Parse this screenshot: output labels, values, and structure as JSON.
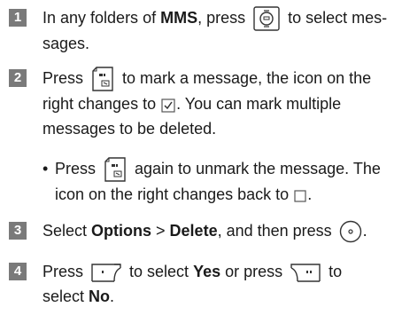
{
  "steps": [
    {
      "number": "1",
      "t1": "In any folders of ",
      "b1": "MMS",
      "t2": ", press ",
      "t3": " to select mes-",
      "t4": "sages."
    },
    {
      "number": "2",
      "t1": "Press ",
      "t2": " to mark a message, the icon on the",
      "t3": "right changes to ",
      "t4": ". You can mark multiple",
      "t5": "messages to be deleted."
    },
    {
      "number": "3",
      "t1": "Select ",
      "b1": "Options",
      "t2": " > ",
      "b2": "Delete",
      "t3": ", and then press ",
      "t4": "."
    },
    {
      "number": "4",
      "t1": "Press ",
      "t2": " to select ",
      "b1": "Yes",
      "t3": " or press ",
      "t4": " to",
      "t5": "select ",
      "b2": "No",
      "t6": "."
    }
  ],
  "bullet": {
    "mark": "•",
    "t1": "Press ",
    "t2": " again to unmark the message. The",
    "t3": "icon on the right changes back to ",
    "t4": "."
  },
  "icons": {
    "nav_key": "navigation-center-key-icon",
    "mark_key": "mark-key-icon",
    "checked_box": "checked-box-icon",
    "unchecked_box": "unchecked-box-icon",
    "ok_key": "ok-key-icon",
    "left_soft_key": "left-soft-key-icon",
    "right_soft_key": "right-soft-key-icon"
  },
  "colors": {
    "number_badge": "#7a7a7a",
    "text": "#1a1a1a"
  }
}
